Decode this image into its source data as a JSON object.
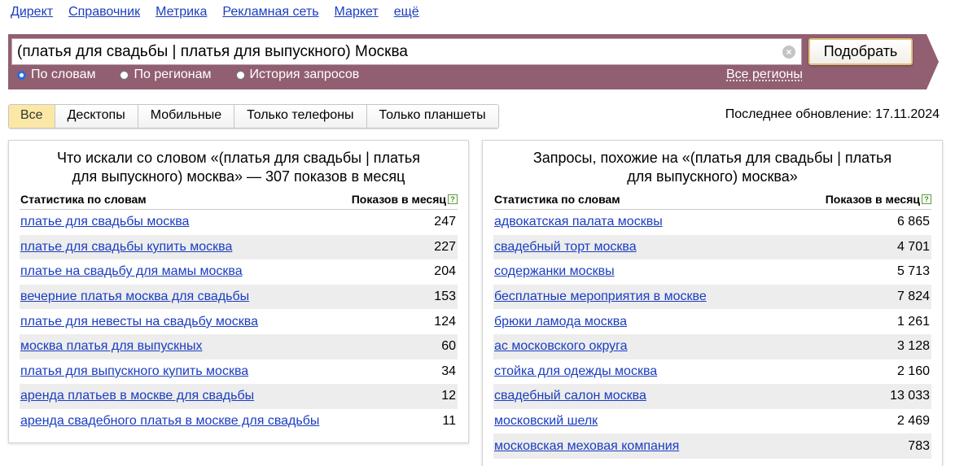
{
  "topnav": [
    "Директ",
    "Справочник",
    "Метрика",
    "Рекламная сеть",
    "Маркет",
    "ещё"
  ],
  "search": {
    "value": "(платья для свадьбы | платья для выпускного) Москва",
    "button": "Подобрать",
    "radios": [
      {
        "label": "По словам",
        "selected": true
      },
      {
        "label": "По регионам",
        "selected": false
      },
      {
        "label": "История запросов",
        "selected": false
      }
    ],
    "all_regions": "Все регионы",
    "bar_color": "#915f71"
  },
  "tabs": [
    "Все",
    "Десктопы",
    "Мобильные",
    "Только телефоны",
    "Только планшеты"
  ],
  "updated": "Последнее обновление: 17.11.2024",
  "left": {
    "title_line1": "Что искали со словом «(платья для свадьбы | платья",
    "title_line2": "для выпускного) москва» — 307 показов в месяц",
    "col1": "Статистика по словам",
    "col2": "Показов в месяц",
    "rows": [
      {
        "q": "платье для свадьбы москва",
        "n": "247"
      },
      {
        "q": "платье для свадьбы купить москва",
        "n": "227"
      },
      {
        "q": "платье на свадьбу для мамы москва",
        "n": "204"
      },
      {
        "q": "вечерние платья москва для свадьбы",
        "n": "153"
      },
      {
        "q": "платье для невесты на свадьбу москва",
        "n": "124"
      },
      {
        "q": "москва платья для выпускных",
        "n": "60"
      },
      {
        "q": "платья для выпускного купить москва",
        "n": "34"
      },
      {
        "q": "аренда платьев в москве для свадьбы",
        "n": "12"
      },
      {
        "q": "аренда свадебного платья в москве для свадьбы",
        "n": "11"
      }
    ]
  },
  "right": {
    "title_line1": "Запросы, похожие на «(платья для свадьбы | платья",
    "title_line2": "для выпускного) москва»",
    "col1": "Статистика по словам",
    "col2": "Показов в месяц",
    "rows": [
      {
        "q": "адвокатская палата москвы",
        "n": "6 865"
      },
      {
        "q": "свадебный торт москва",
        "n": "4 701"
      },
      {
        "q": "содержанки москвы",
        "n": "5 713"
      },
      {
        "q": "бесплатные мероприятия в москве",
        "n": "7 824"
      },
      {
        "q": "брюки ламода москва",
        "n": "1 261"
      },
      {
        "q": "ас московского округа",
        "n": "3 128"
      },
      {
        "q": "стойка для одежды москва",
        "n": "2 160"
      },
      {
        "q": "свадебный салон москва",
        "n": "13 033"
      },
      {
        "q": "московский шелк",
        "n": "2 469"
      },
      {
        "q": "московская меховая компания",
        "n": "783"
      }
    ]
  }
}
